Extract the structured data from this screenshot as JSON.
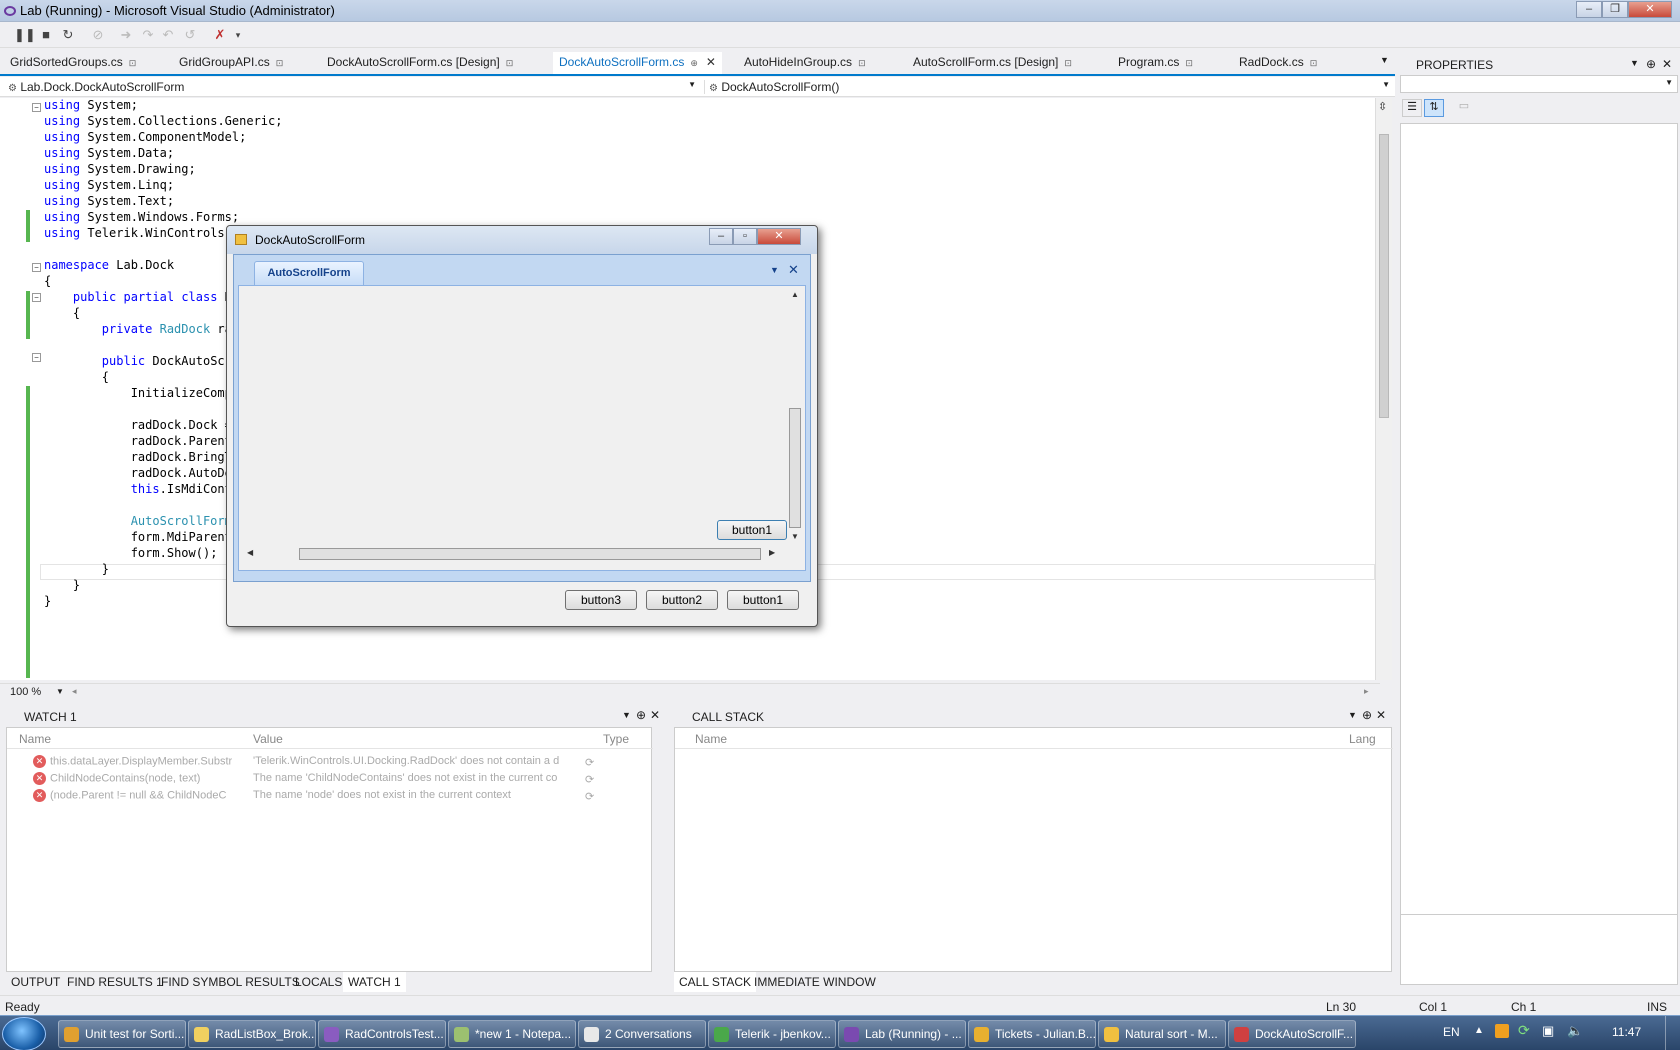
{
  "window": {
    "title": "Lab (Running) - Microsoft Visual Studio (Administrator)"
  },
  "tabs": [
    {
      "label": "GridSortedGroups.cs"
    },
    {
      "label": "GridGroupAPI.cs"
    },
    {
      "label": "DockAutoScrollForm.cs [Design]"
    },
    {
      "label": "DockAutoScrollForm.cs"
    },
    {
      "label": "AutoHideInGroup.cs"
    },
    {
      "label": "AutoScrollForm.cs [Design]"
    },
    {
      "label": "Program.cs"
    },
    {
      "label": "RadDock.cs"
    }
  ],
  "nav": {
    "class_combo": "Lab.Dock.DockAutoScrollForm",
    "member_combo": "DockAutoScrollForm()"
  },
  "code": [
    "using System;",
    "using System.Collections.Generic;",
    "using System.ComponentModel;",
    "using System.Data;",
    "using System.Drawing;",
    "using System.Linq;",
    "using System.Text;",
    "using System.Windows.Forms;",
    "using Telerik.WinControls.",
    "",
    "namespace Lab.Dock",
    "{",
    "    public partial class D",
    "    {",
    "        private RadDock ra",
    "",
    "        public DockAutoScr",
    "        {",
    "            InitializeComp",
    "",
    "            radDock.Dock =",
    "            radDock.Parent",
    "            radDock.BringT",
    "            radDock.AutoDe",
    "            this.IsMdiCont",
    "",
    "            AutoScrollForm",
    "            form.MdiParent",
    "            form.Show();",
    "        }",
    "    }",
    "}"
  ],
  "zoom": "100 %",
  "properties": {
    "title": "PROPERTIES"
  },
  "dialog": {
    "title": "DockAutoScrollForm",
    "doc_tab": "AutoScrollForm",
    "inner_button": "button1",
    "buttons": [
      "button3",
      "button2",
      "button1"
    ]
  },
  "watch": {
    "title": "WATCH 1",
    "cols": {
      "name": "Name",
      "value": "Value",
      "type": "Type"
    },
    "rows": [
      {
        "name": "this.dataLayer.DisplayMember.Substr",
        "value": "'Telerik.WinControls.UI.Docking.RadDock' does not contain a d"
      },
      {
        "name": "ChildNodeContains(node, text)",
        "value": "The name 'ChildNodeContains' does not exist in the current co"
      },
      {
        "name": "(node.Parent != null && ChildNodeC",
        "value": "The name 'node' does not exist in the current context"
      }
    ]
  },
  "callstack": {
    "title": "CALL STACK",
    "cols": {
      "name": "Name",
      "lang": "Lang"
    }
  },
  "bottom_tabs_left": [
    "OUTPUT",
    "FIND RESULTS 1",
    "FIND SYMBOL RESULTS",
    "LOCALS",
    "WATCH 1"
  ],
  "bottom_tabs_right": [
    "CALL STACK",
    "IMMEDIATE WINDOW"
  ],
  "status": {
    "left": "Ready",
    "ln": "Ln 30",
    "col": "Col 1",
    "ch": "Ch 1",
    "ins": "INS"
  },
  "taskbar": {
    "items": [
      {
        "label": "Unit test for Sorti...",
        "color": "#e0a030"
      },
      {
        "label": "RadListBox_Brok...",
        "color": "#f0d060"
      },
      {
        "label": "RadControlsTest...",
        "color": "#8a5cc0"
      },
      {
        "label": "*new 1 - Notepa...",
        "color": "#9cc070"
      },
      {
        "label": "2 Conversations",
        "color": "#e8e8e8"
      },
      {
        "label": "Telerik - jbenkov...",
        "color": "#4aa84a"
      },
      {
        "label": "Lab (Running) - ...",
        "color": "#7a4ab0"
      },
      {
        "label": "Tickets - Julian.B...",
        "color": "#e8b030"
      },
      {
        "label": "Natural sort - M...",
        "color": "#f0c040"
      },
      {
        "label": "DockAutoScrollF...",
        "color": "#d04040"
      }
    ],
    "lang": "EN",
    "clock": "11:47"
  }
}
